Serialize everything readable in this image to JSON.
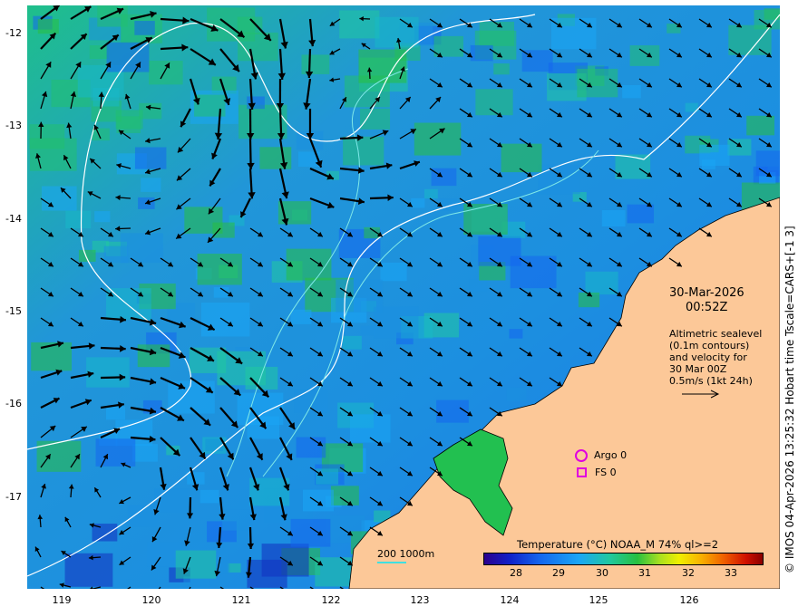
{
  "credit": "© IMOS 04-Apr-2026 13:25:32 Hobart time Tscale=CARS+[-1 3]",
  "timestamp": {
    "date": "30-Mar-2026",
    "time": "00:52Z"
  },
  "description": [
    "Altimetric sealevel",
    "(0.1m contours)",
    "and velocity for",
    "30 Mar 00Z",
    "0.5m/s (1kt 24h)"
  ],
  "markers": {
    "argo": "Argo 0",
    "fs": "FS 0"
  },
  "depth_legend": "200  1000m",
  "colorbar": {
    "title": "Temperature (°C) NOAA_M 74% ql>=2",
    "ticks": [
      "28",
      "29",
      "30",
      "31",
      "32",
      "33"
    ],
    "colors": [
      "#2a008e",
      "#1466ee",
      "#1aa6f6",
      "#28c040",
      "#f0f000",
      "#f06000",
      "#8a0000"
    ]
  },
  "axes": {
    "lat_ticks": [
      "-12",
      "-13",
      "-14",
      "-15",
      "-16",
      "-17"
    ],
    "lon_ticks": [
      "119",
      "120",
      "121",
      "122",
      "123",
      "124",
      "125",
      "126"
    ]
  },
  "colors": {
    "land": "#fcc898",
    "coast": "#000000",
    "contour": "#ffffff",
    "isobath": "#7fe8e8",
    "arrow": "#000000"
  }
}
